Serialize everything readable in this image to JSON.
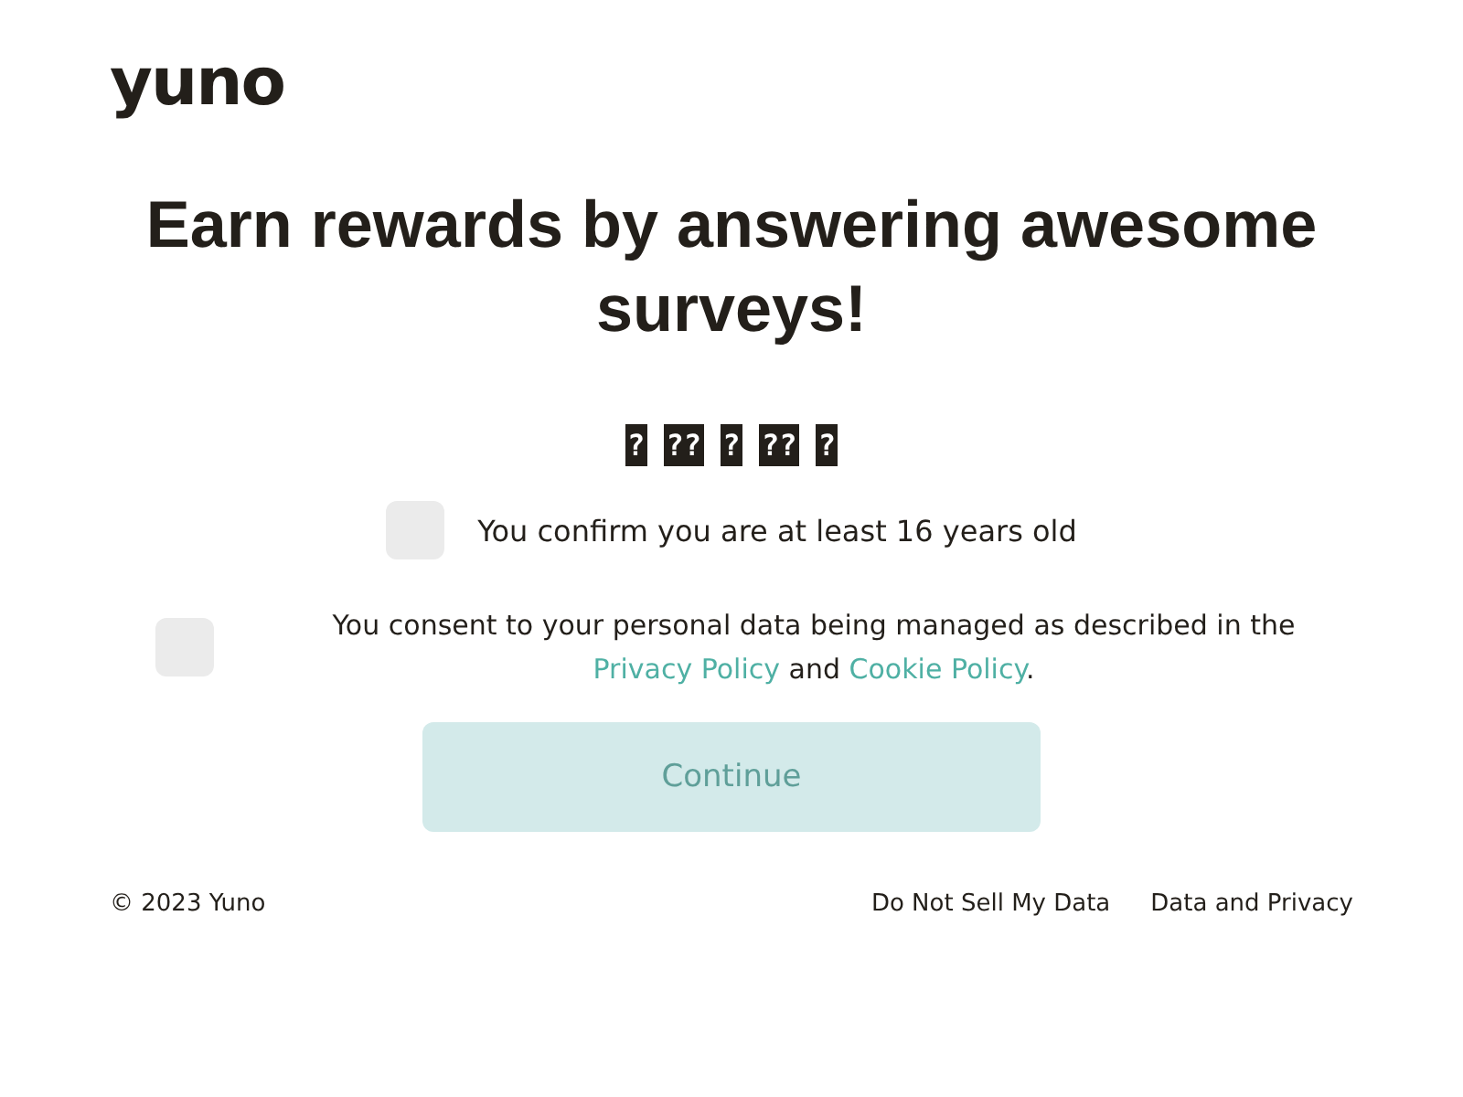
{
  "logo": "yuno",
  "headline": "Earn rewards by answering awesome surveys!",
  "unrendered_text": "? ?? ? ?? ?",
  "consents": [
    {
      "kind": "age",
      "checked": false,
      "text": "You confirm you are at least 16 years old"
    },
    {
      "kind": "policy",
      "checked": false,
      "text": "You consent to your personal data being managed as described in the",
      "link1": "Privacy Policy",
      "joiner": "and",
      "link2": "Cookie Policy",
      "end": "."
    }
  ],
  "continue_button": {
    "label": "Continue",
    "disabled": true
  },
  "footer": {
    "copyright": "© 2023 Yuno",
    "links": [
      "Do Not Sell My Data",
      "Data and Privacy"
    ]
  }
}
